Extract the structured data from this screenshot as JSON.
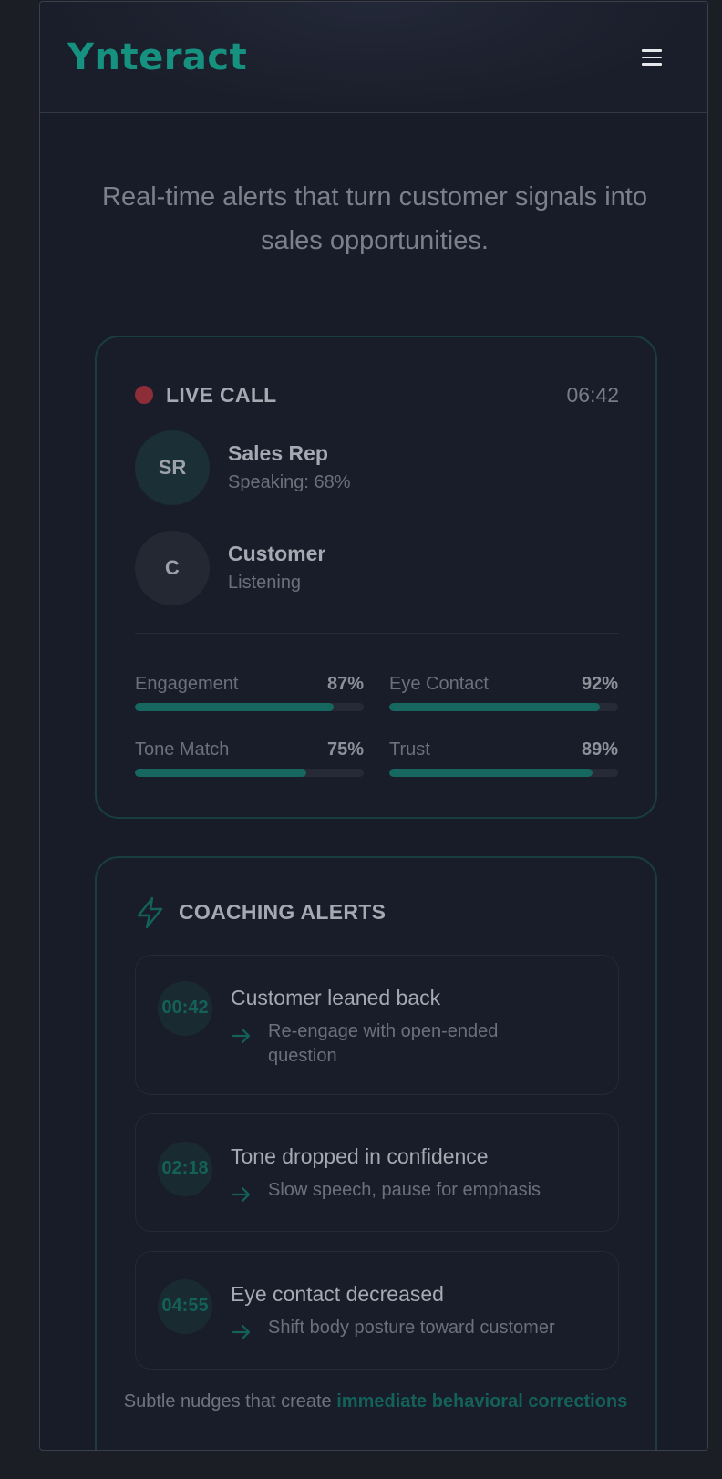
{
  "brand": {
    "logo": "Ynteract",
    "accent": "#17917f"
  },
  "nav": {
    "menu_icon": "hamburger-menu-icon"
  },
  "hero": {
    "tagline": "Real-time alerts that turn customer signals into sales opportunities."
  },
  "live_call": {
    "label": "LIVE CALL",
    "timer": "06:42",
    "participants": [
      {
        "initials": "SR",
        "name": "Sales Rep",
        "status": "Speaking: 68%"
      },
      {
        "initials": "C",
        "name": "Customer",
        "status": "Listening"
      }
    ],
    "metrics": [
      {
        "label": "Engagement",
        "value": "87%",
        "level": 0.87
      },
      {
        "label": "Eye Contact",
        "value": "92%",
        "level": 0.92
      },
      {
        "label": "Tone Match",
        "value": "75%",
        "level": 0.75
      },
      {
        "label": "Trust",
        "value": "89%",
        "level": 0.89
      }
    ]
  },
  "coaching": {
    "title": "COACHING ALERTS",
    "icon": "lightning-bolt-icon",
    "alerts": [
      {
        "time": "00:42",
        "title": "Customer leaned back",
        "action": "Re-engage with open-ended question"
      },
      {
        "time": "02:18",
        "title": "Tone dropped in confidence",
        "action": "Slow speech, pause for emphasis"
      },
      {
        "time": "04:55",
        "title": "Eye contact decreased",
        "action": "Shift body posture toward customer"
      }
    ],
    "footer_prefix": "Subtle nudges that create ",
    "footer_highlight": "immediate behavioral corrections"
  }
}
